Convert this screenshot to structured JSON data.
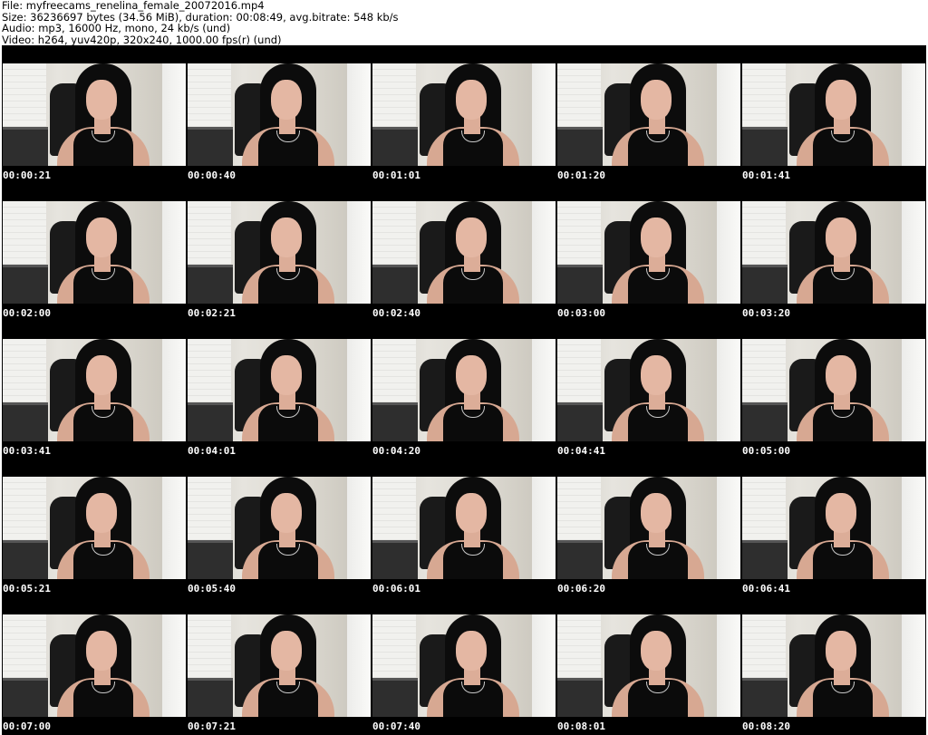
{
  "header": {
    "file": "File: myfreecams_renelina_female_20072016.mp4",
    "size": "Size: 36236697 bytes (34.56 MiB), duration: 00:08:49, avg.bitrate: 548 kb/s",
    "audio": "Audio: mp3, 16000 Hz, mono, 24 kb/s (und)",
    "video": "Video: h264, yuv420p, 320x240, 1000.00 fps(r) (und)"
  },
  "thumbnails": [
    {
      "timestamp": "00:00:21"
    },
    {
      "timestamp": "00:00:40"
    },
    {
      "timestamp": "00:01:01"
    },
    {
      "timestamp": "00:01:20"
    },
    {
      "timestamp": "00:01:41"
    },
    {
      "timestamp": "00:02:00"
    },
    {
      "timestamp": "00:02:21"
    },
    {
      "timestamp": "00:02:40"
    },
    {
      "timestamp": "00:03:00"
    },
    {
      "timestamp": "00:03:20"
    },
    {
      "timestamp": "00:03:41"
    },
    {
      "timestamp": "00:04:01"
    },
    {
      "timestamp": "00:04:20"
    },
    {
      "timestamp": "00:04:41"
    },
    {
      "timestamp": "00:05:00"
    },
    {
      "timestamp": "00:05:21"
    },
    {
      "timestamp": "00:05:40"
    },
    {
      "timestamp": "00:06:01"
    },
    {
      "timestamp": "00:06:20"
    },
    {
      "timestamp": "00:06:41"
    },
    {
      "timestamp": "00:07:00"
    },
    {
      "timestamp": "00:07:21"
    },
    {
      "timestamp": "00:07:40"
    },
    {
      "timestamp": "00:08:01"
    },
    {
      "timestamp": "00:08:20"
    }
  ],
  "colors": {
    "background": "#ffffff",
    "sheet": "#000000",
    "timestamp_text": "#ffffff",
    "header_text": "#000000"
  }
}
